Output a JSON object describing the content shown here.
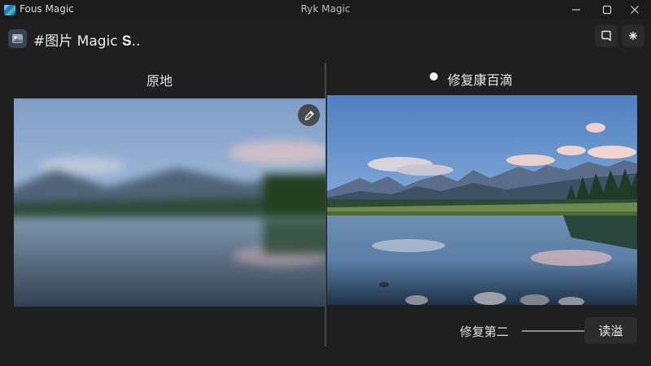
{
  "window": {
    "app_name": "Fous Magic",
    "title": "Ryk Magic",
    "controls": [
      "minimize-icon",
      "maximize-icon",
      "close-icon"
    ]
  },
  "toolbar": {
    "icon": "photo-icon",
    "title": "#图片 Magic 𝐒..",
    "buttons": [
      "bookmark-icon",
      "sparkle-icon"
    ]
  },
  "comparison": {
    "original_label": "原地",
    "restored_label": "修复康百滴",
    "status_indicator": "dot",
    "original_tool_icon": "eyedropper-icon"
  },
  "footer": {
    "strength_label": "修复第二",
    "action_button": "读溢"
  },
  "colors": {
    "background": "#1f1f1f",
    "titlebar": "#1b1b1b",
    "divider": "#4a4a4a",
    "button_bg": "#2c2c2c",
    "text": "#e8e8e8"
  }
}
